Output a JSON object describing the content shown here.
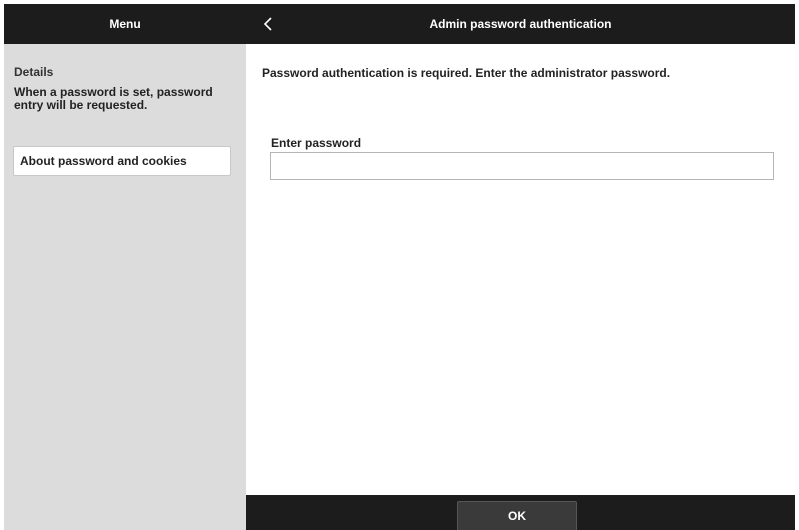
{
  "sidebar": {
    "header": "Menu",
    "details_heading": "Details",
    "details_text": "When a password is set, password entry will be requested.",
    "about_link": "About password and cookies"
  },
  "main": {
    "back_icon": "chevron-left-icon",
    "title": "Admin password authentication",
    "instruction": "Password authentication is required. Enter the administrator password.",
    "password_label": "Enter password",
    "password_value": "",
    "password_placeholder": ""
  },
  "footer": {
    "ok_label": "OK"
  },
  "colors": {
    "header_bg": "#1c1c1c",
    "sidebar_bg": "#dcdcdc",
    "main_bg": "#ffffff",
    "button_bg": "#3a3a3a"
  }
}
